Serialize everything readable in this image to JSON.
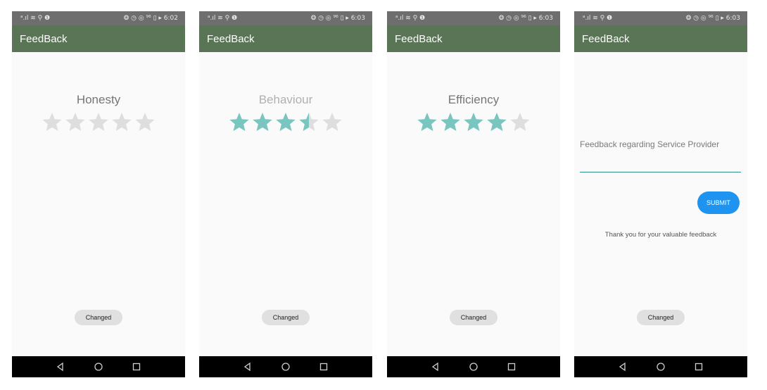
{
  "status_bar": [
    {
      "left": "ᵃ.ıl ≋ ⚲ ❶",
      "right": "❂ ◷ ◎ ⁹⁶ ▯ ▸ 6:02"
    },
    {
      "left": "ᵃ.ıl ≋ ⚲ ❶",
      "right": "❂ ◷ ◎ ⁹⁶ ▯ ▸ 6:03"
    },
    {
      "left": "ᵃ.ıl ≋ ⚲ ❶",
      "right": "❂ ◷ ◎ ⁹⁶ ▯ ▸ 6:03"
    },
    {
      "left": "ᵃ.ıl ≋ ⚲ ❶",
      "right": "❂ ◷ ◎ ⁹⁶ ▯ ▸ 6:03"
    }
  ],
  "app_title": "FeedBack",
  "screens": [
    {
      "rating_title": "Honesty",
      "rating": 0,
      "rating_max": 5
    },
    {
      "rating_title": "Behaviour",
      "rating": 3.5,
      "rating_max": 5
    },
    {
      "rating_title": "Efficiency",
      "rating": 4,
      "rating_max": 5
    }
  ],
  "feedback_form": {
    "label": "Feedback regarding Service Provider",
    "input_value": "",
    "submit_label": "SUBMIT",
    "thanks_message": "Thank you for your valuable feedback"
  },
  "changed_button_label": "Changed",
  "colors": {
    "app_bar": "#5a7556",
    "status_bar": "#6e6e6e",
    "star_filled": "#79c5bf",
    "star_empty": "#dedede",
    "submit_button": "#1e94f0",
    "input_underline": "#2f8f8a"
  },
  "icons": [
    "back-icon",
    "home-icon",
    "recents-icon",
    "star-icon"
  ]
}
